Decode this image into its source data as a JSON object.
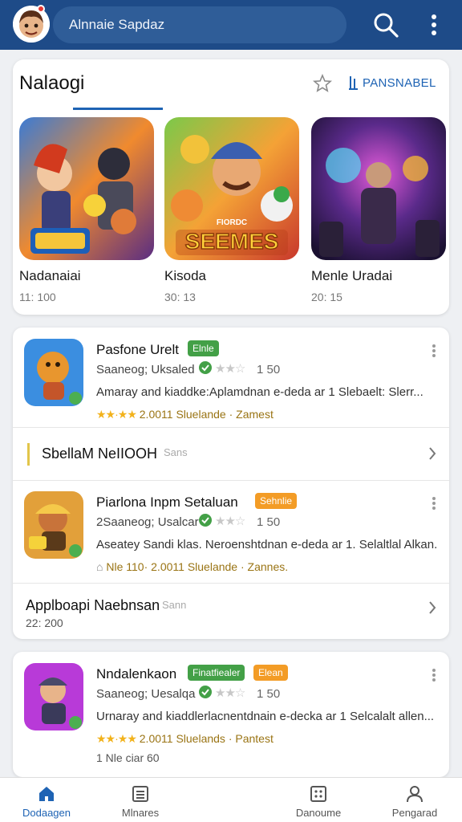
{
  "header": {
    "search_placeholder": "Alnnaie Sapdaz"
  },
  "featured": {
    "title": "Nalaogi",
    "link": "PANSNABEL",
    "games": [
      {
        "name": "Nadanaiai",
        "meta": "11: 100",
        "art": "game-art-heroes"
      },
      {
        "name": "Kisoda",
        "meta": "30: 13",
        "art": "game-art-seemes"
      },
      {
        "name": "Menle Uradai",
        "meta": "20: 15",
        "art": "game-art-wizard"
      }
    ],
    "art_logo_text": "SEEMES",
    "art_logo_small": "FIORDC"
  },
  "list1": {
    "app1": {
      "name": "Pasfone Urelt",
      "badge": "Elnle",
      "subline": "Saaneog; Uksaled",
      "rating": "1 50",
      "desc": "Amaray and kiaddke:Aplamdnan e-deda ar 1 Slebaelt: Slerr...",
      "stars": "★★·★★",
      "meta_num": "2.0011",
      "meta_label": "Sluelande",
      "meta_tail": "· Zamest"
    },
    "section1": {
      "title": "SbellaM NeIIOOH",
      "sub": "Sans"
    },
    "app2": {
      "name": "Piarlona Inpm Setaluan",
      "badge": "Sehnlie",
      "subline": "2Saaneog; Usalcar",
      "rating": "1 50",
      "desc": "Aseatey Sandi klas. Neroenshtdnan e-deda ar 1. Selaltlal Alkan...",
      "prefix": "Nle 110·",
      "meta_num": "2.0011",
      "meta_label": "Sluelande",
      "meta_tail": "· Zannes."
    },
    "section2": {
      "title": "Applboapi Naebnsan",
      "sub": "Sann",
      "meta": "22: 200"
    }
  },
  "list2": {
    "app3": {
      "name": "Nndalenkaon",
      "badge1": "Finatfiealer",
      "badge2": "Elean",
      "subline": "Saaneog; Uesalqa",
      "rating": "1 50",
      "desc": "Urnaray and kiaddlerlacnentdnain e-decka ar 1 Selcalalt allen...",
      "stars": "★★·★★",
      "meta_num": "2.0011",
      "meta_label": "Sluelands",
      "meta_tail": "· Pantest",
      "extra": "1 Nle ciar  60"
    }
  },
  "bottom_nav": {
    "items": [
      {
        "label": "Dodaagen",
        "icon": "home-icon",
        "active": true
      },
      {
        "label": "Mlnares",
        "icon": "list-icon",
        "active": false
      },
      {
        "label": "Danoume",
        "icon": "grid-icon",
        "active": false
      },
      {
        "label": "Pengarad",
        "icon": "person-icon",
        "active": false
      }
    ]
  },
  "colors": {
    "header_bg": "#1e4b88",
    "accent": "#1e63b4",
    "badge_green": "#43a047",
    "badge_orange": "#f39c26",
    "star_gold": "#f2b21b"
  }
}
